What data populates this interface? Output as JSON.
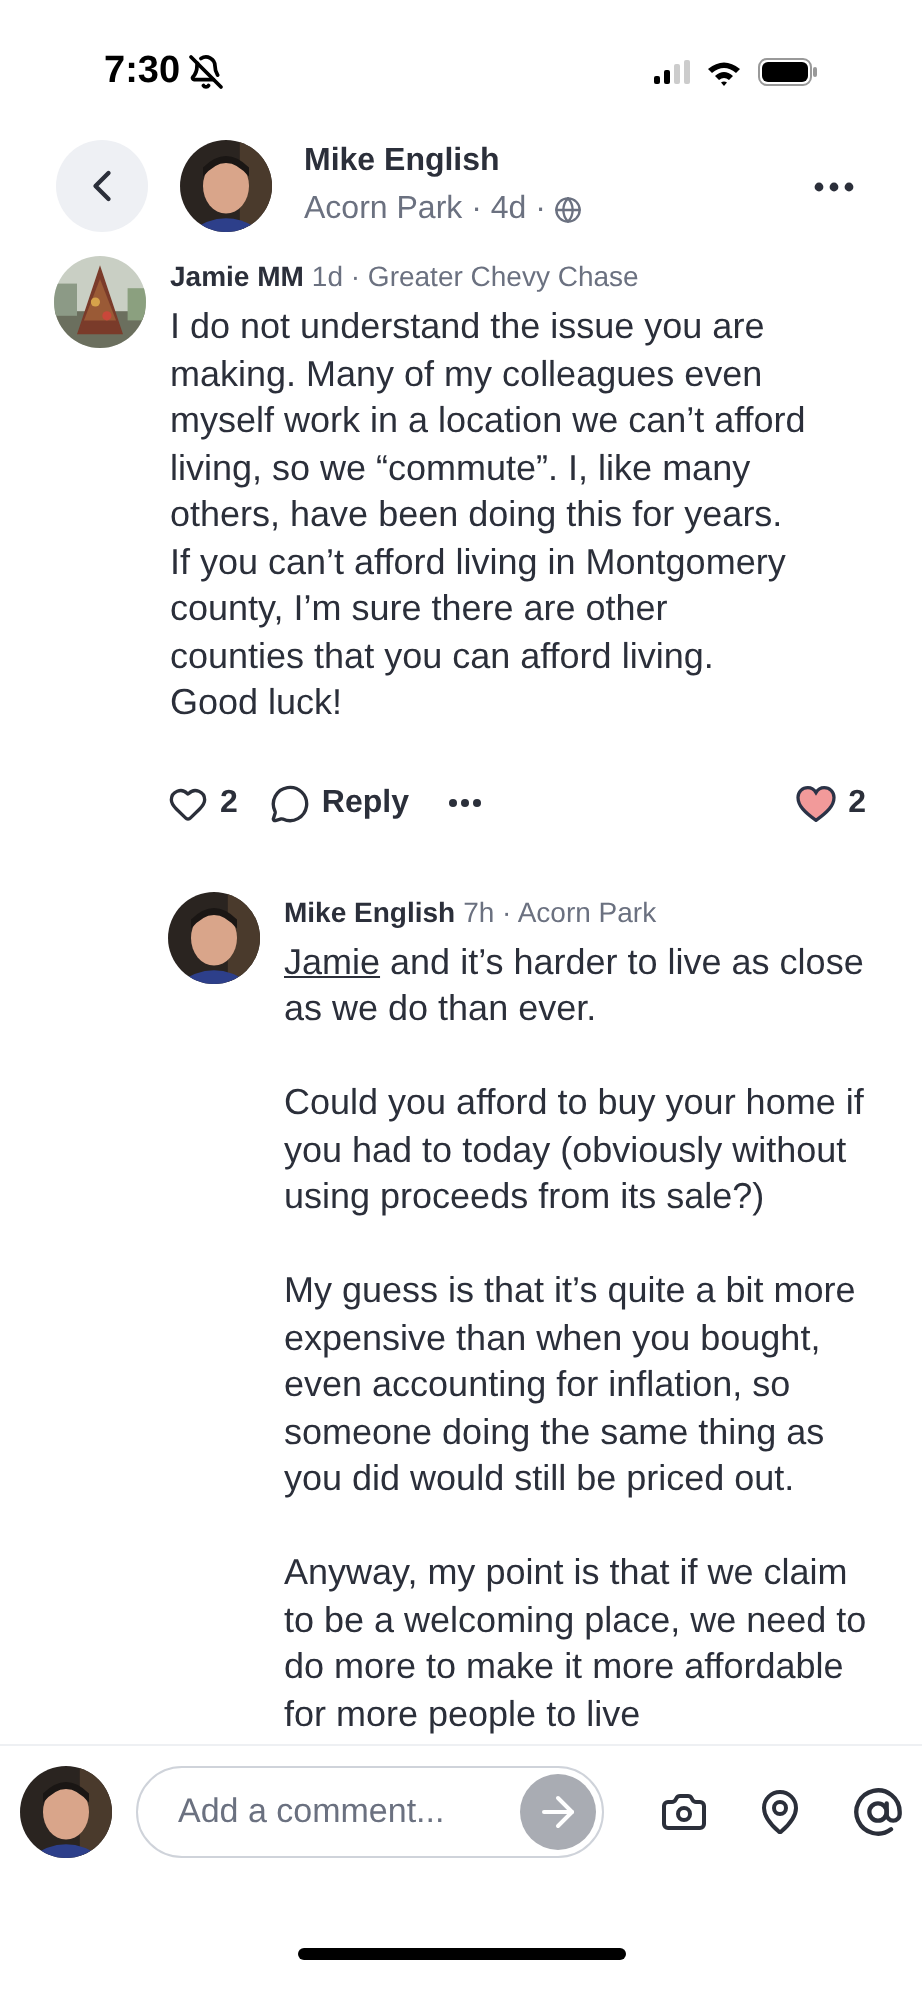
{
  "status_bar": {
    "time": "7:30"
  },
  "header": {
    "author": "Mike English",
    "meta": "Acorn Park · 4d ·"
  },
  "comment": {
    "author": "Jamie MM",
    "meta": "1d · Greater Chevy Chase",
    "text": "I do not understand the issue you are making. Many of my colleagues even myself work in a location we can’t afford living, so we “commute”. I, like many others, have been doing this for years. If you can’t afford living in Montgomery county, I’m sure there are other counties that you can afford living.  Good luck!",
    "actions": {
      "like_count": "2",
      "liked": false,
      "reply": "Reply",
      "reaction_count": "2"
    }
  },
  "reply": {
    "author": "Mike English",
    "meta": "7h · Acorn Park",
    "mention": "Jamie",
    "paragraphs": [
      "and it’s harder to live as close as we do than ever.",
      "Could you afford to buy your home if you had to today (obviously without using proceeds from its sale?)",
      "My guess is that it’s quite a bit more expensive than when you bought, even accounting for inflation, so someone  doing the same thing as you did would still be priced out.",
      "Anyway, my point is that if we claim to be a welcoming place, we need to do more to make it more affordable for more people to live"
    ]
  },
  "composer": {
    "placeholder": "Add a comment..."
  }
}
